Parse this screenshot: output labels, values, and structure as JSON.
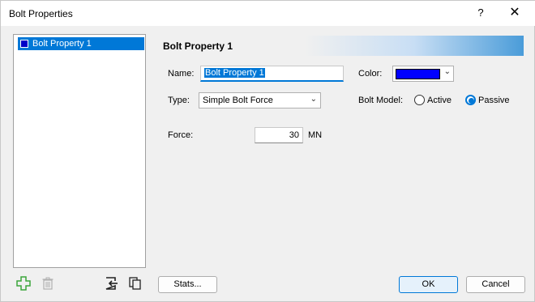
{
  "window": {
    "title": "Bolt Properties",
    "help_label": "?",
    "close_label": "✕"
  },
  "list": {
    "items": [
      {
        "label": "Bolt Property 1",
        "color": "#0000c8",
        "selected": true
      }
    ]
  },
  "header": {
    "title": "Bolt Property 1"
  },
  "form": {
    "name_label": "Name:",
    "name_value": "Bolt Property 1",
    "color_label": "Color:",
    "color_value": "#0000ff",
    "type_label": "Type:",
    "type_value": "Simple Bolt Force",
    "bolt_model_label": "Bolt Model:",
    "bolt_model_options": [
      {
        "label": "Active",
        "checked": false
      },
      {
        "label": "Passive",
        "checked": true
      }
    ],
    "force_label": "Force:",
    "force_value": "30",
    "force_unit": "MN"
  },
  "toolbar": {
    "add_icon": "add-plus-icon",
    "delete_icon": "trash-icon",
    "import_icon": "import-icon",
    "copy_icon": "copy-icon"
  },
  "buttons": {
    "stats_label": "Stats...",
    "ok_label": "OK",
    "cancel_label": "Cancel"
  },
  "colors": {
    "accent": "#0078d7",
    "selection": "#0078d7",
    "add_icon": "#3aa53a"
  }
}
